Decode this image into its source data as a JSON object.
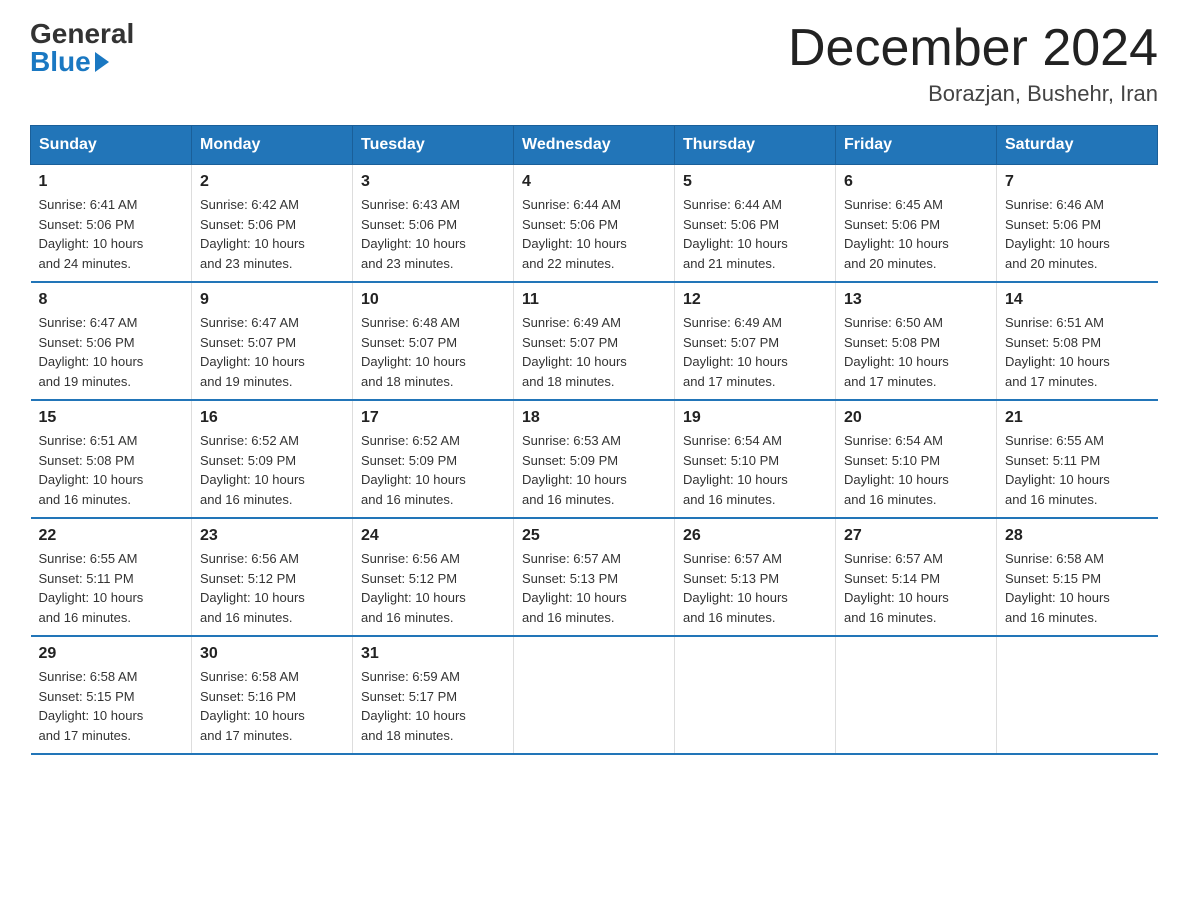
{
  "logo": {
    "general": "General",
    "blue": "Blue"
  },
  "header": {
    "month": "December 2024",
    "location": "Borazjan, Bushehr, Iran"
  },
  "weekdays": [
    "Sunday",
    "Monday",
    "Tuesday",
    "Wednesday",
    "Thursday",
    "Friday",
    "Saturday"
  ],
  "weeks": [
    [
      {
        "day": "1",
        "sunrise": "6:41 AM",
        "sunset": "5:06 PM",
        "daylight": "10 hours and 24 minutes."
      },
      {
        "day": "2",
        "sunrise": "6:42 AM",
        "sunset": "5:06 PM",
        "daylight": "10 hours and 23 minutes."
      },
      {
        "day": "3",
        "sunrise": "6:43 AM",
        "sunset": "5:06 PM",
        "daylight": "10 hours and 23 minutes."
      },
      {
        "day": "4",
        "sunrise": "6:44 AM",
        "sunset": "5:06 PM",
        "daylight": "10 hours and 22 minutes."
      },
      {
        "day": "5",
        "sunrise": "6:44 AM",
        "sunset": "5:06 PM",
        "daylight": "10 hours and 21 minutes."
      },
      {
        "day": "6",
        "sunrise": "6:45 AM",
        "sunset": "5:06 PM",
        "daylight": "10 hours and 20 minutes."
      },
      {
        "day": "7",
        "sunrise": "6:46 AM",
        "sunset": "5:06 PM",
        "daylight": "10 hours and 20 minutes."
      }
    ],
    [
      {
        "day": "8",
        "sunrise": "6:47 AM",
        "sunset": "5:06 PM",
        "daylight": "10 hours and 19 minutes."
      },
      {
        "day": "9",
        "sunrise": "6:47 AM",
        "sunset": "5:07 PM",
        "daylight": "10 hours and 19 minutes."
      },
      {
        "day": "10",
        "sunrise": "6:48 AM",
        "sunset": "5:07 PM",
        "daylight": "10 hours and 18 minutes."
      },
      {
        "day": "11",
        "sunrise": "6:49 AM",
        "sunset": "5:07 PM",
        "daylight": "10 hours and 18 minutes."
      },
      {
        "day": "12",
        "sunrise": "6:49 AM",
        "sunset": "5:07 PM",
        "daylight": "10 hours and 17 minutes."
      },
      {
        "day": "13",
        "sunrise": "6:50 AM",
        "sunset": "5:08 PM",
        "daylight": "10 hours and 17 minutes."
      },
      {
        "day": "14",
        "sunrise": "6:51 AM",
        "sunset": "5:08 PM",
        "daylight": "10 hours and 17 minutes."
      }
    ],
    [
      {
        "day": "15",
        "sunrise": "6:51 AM",
        "sunset": "5:08 PM",
        "daylight": "10 hours and 16 minutes."
      },
      {
        "day": "16",
        "sunrise": "6:52 AM",
        "sunset": "5:09 PM",
        "daylight": "10 hours and 16 minutes."
      },
      {
        "day": "17",
        "sunrise": "6:52 AM",
        "sunset": "5:09 PM",
        "daylight": "10 hours and 16 minutes."
      },
      {
        "day": "18",
        "sunrise": "6:53 AM",
        "sunset": "5:09 PM",
        "daylight": "10 hours and 16 minutes."
      },
      {
        "day": "19",
        "sunrise": "6:54 AM",
        "sunset": "5:10 PM",
        "daylight": "10 hours and 16 minutes."
      },
      {
        "day": "20",
        "sunrise": "6:54 AM",
        "sunset": "5:10 PM",
        "daylight": "10 hours and 16 minutes."
      },
      {
        "day": "21",
        "sunrise": "6:55 AM",
        "sunset": "5:11 PM",
        "daylight": "10 hours and 16 minutes."
      }
    ],
    [
      {
        "day": "22",
        "sunrise": "6:55 AM",
        "sunset": "5:11 PM",
        "daylight": "10 hours and 16 minutes."
      },
      {
        "day": "23",
        "sunrise": "6:56 AM",
        "sunset": "5:12 PM",
        "daylight": "10 hours and 16 minutes."
      },
      {
        "day": "24",
        "sunrise": "6:56 AM",
        "sunset": "5:12 PM",
        "daylight": "10 hours and 16 minutes."
      },
      {
        "day": "25",
        "sunrise": "6:57 AM",
        "sunset": "5:13 PM",
        "daylight": "10 hours and 16 minutes."
      },
      {
        "day": "26",
        "sunrise": "6:57 AM",
        "sunset": "5:13 PM",
        "daylight": "10 hours and 16 minutes."
      },
      {
        "day": "27",
        "sunrise": "6:57 AM",
        "sunset": "5:14 PM",
        "daylight": "10 hours and 16 minutes."
      },
      {
        "day": "28",
        "sunrise": "6:58 AM",
        "sunset": "5:15 PM",
        "daylight": "10 hours and 16 minutes."
      }
    ],
    [
      {
        "day": "29",
        "sunrise": "6:58 AM",
        "sunset": "5:15 PM",
        "daylight": "10 hours and 17 minutes."
      },
      {
        "day": "30",
        "sunrise": "6:58 AM",
        "sunset": "5:16 PM",
        "daylight": "10 hours and 17 minutes."
      },
      {
        "day": "31",
        "sunrise": "6:59 AM",
        "sunset": "5:17 PM",
        "daylight": "10 hours and 18 minutes."
      },
      null,
      null,
      null,
      null
    ]
  ]
}
